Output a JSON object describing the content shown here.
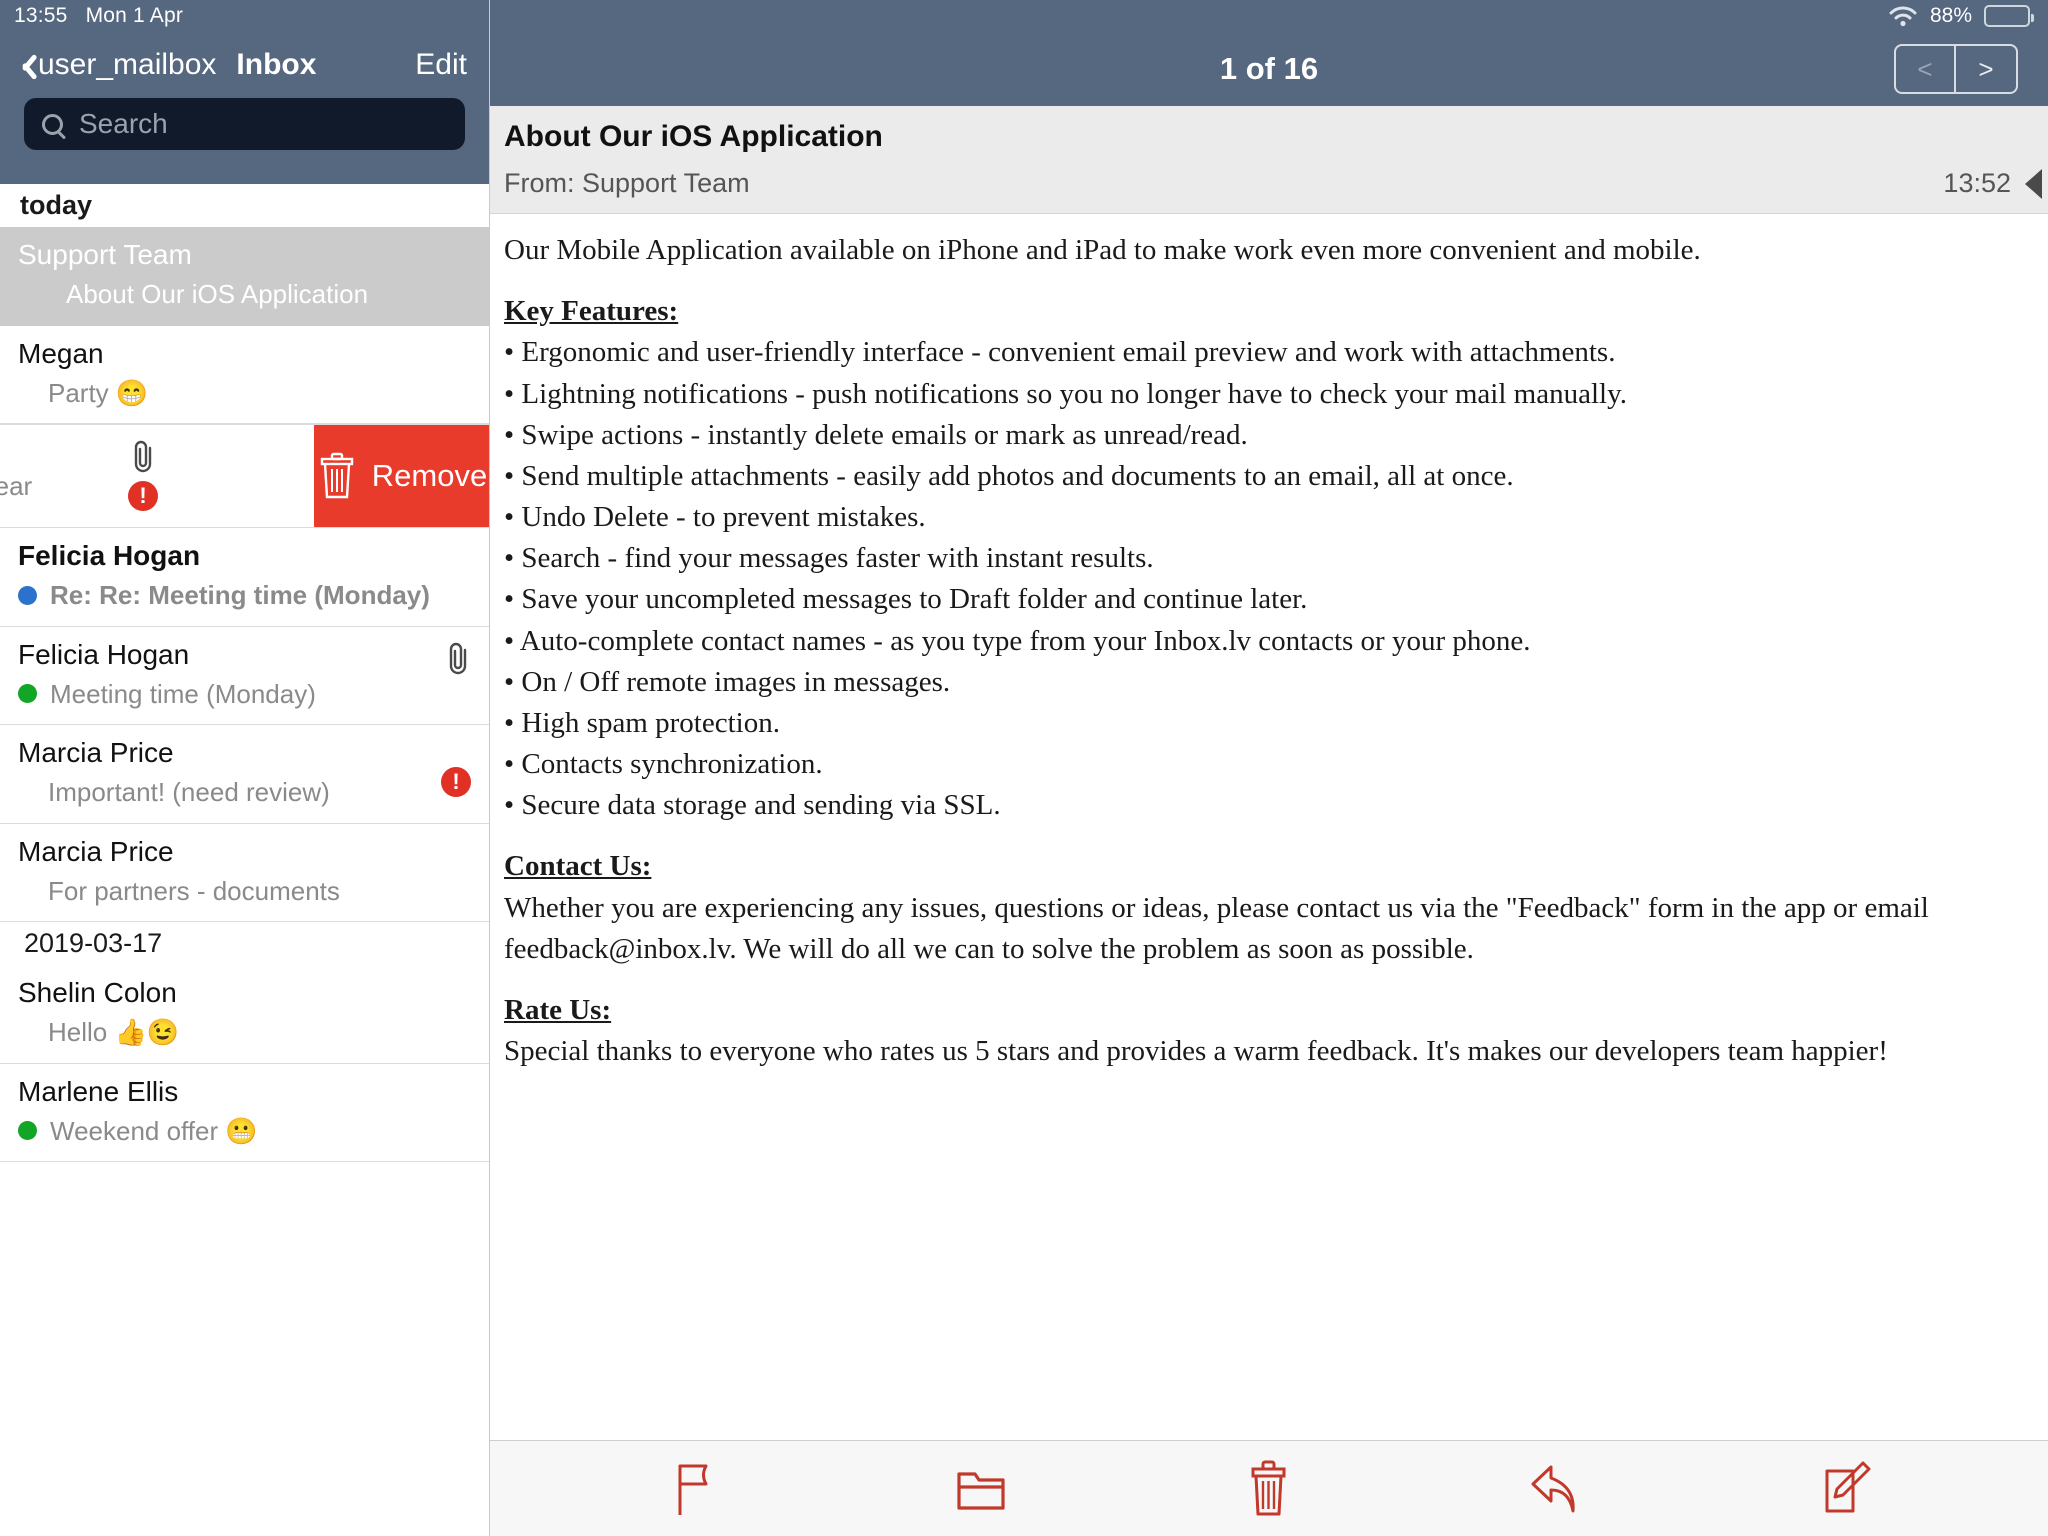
{
  "status_bar": {
    "time": "13:55",
    "date": "Mon 1 Apr",
    "battery_percent": "88%",
    "wifi_icon": "wifi-icon",
    "battery_icon": "battery-icon"
  },
  "left_pane": {
    "back_label": "user_mailbox",
    "back_icon": "chevron-left-icon",
    "title": "Inbox",
    "edit_label": "Edit",
    "search": {
      "placeholder": "Search",
      "value": "",
      "icon": "search-icon"
    },
    "sections": [
      {
        "header": "today",
        "rows": [
          {
            "sender": "Support Team",
            "subject": "About Our iOS Application",
            "selected": true,
            "unread": false,
            "dot": "none",
            "attachment": false,
            "important": false
          },
          {
            "sender": "Megan",
            "subject": "Party 😁",
            "selected": false,
            "unread": false,
            "dot": "none",
            "attachment": false,
            "important": false
          }
        ]
      }
    ],
    "swipe_row": {
      "subject_fragment": "ents for this year",
      "attachment_icon": "paperclip-icon",
      "important_icon": "exclamation-badge-icon",
      "action_label": "Remove",
      "action_icon": "trash-icon",
      "action_color": "#e83b2b"
    },
    "rows_after_swipe": [
      {
        "sender": "Felicia Hogan",
        "subject": "Re: Re: Meeting time (Monday)",
        "unread": true,
        "dot": "blue",
        "attachment": false,
        "important": false
      },
      {
        "sender": "Felicia Hogan",
        "subject": "Meeting time (Monday)",
        "unread": false,
        "dot": "green",
        "attachment": true,
        "important": false
      },
      {
        "sender": "Marcia Price",
        "subject": "Important! (need review)",
        "unread": false,
        "dot": "none",
        "attachment": false,
        "important": true
      },
      {
        "sender": "Marcia Price",
        "subject": "For partners - documents",
        "unread": false,
        "dot": "none",
        "attachment": false,
        "important": false
      }
    ],
    "section_dated": {
      "header": "2019-03-17",
      "rows": [
        {
          "sender": "Shelin Colon",
          "subject": "Hello 👍😉",
          "unread": false,
          "dot": "none",
          "attachment": false,
          "important": false
        },
        {
          "sender": "Marlene    Ellis",
          "subject": "Weekend offer 😬",
          "unread": false,
          "dot": "green",
          "attachment": false,
          "important": false
        }
      ]
    }
  },
  "right_pane": {
    "message_counter": "1 of 16",
    "prev_label": "<",
    "next_label": ">",
    "subject": "About Our iOS Application",
    "from": "From: Support Team",
    "time": "13:52",
    "reply_indicator_icon": "triangle-left-icon",
    "body": {
      "intro": "Our Mobile Application available on iPhone and iPad to make work even more convenient and mobile.",
      "features_heading": "Key Features:",
      "features": [
        "• Ergonomic and user-friendly interface - convenient email preview and work with attachments.",
        "• Lightning notifications - push notifications so you no longer have to check your mail manually.",
        "• Swipe actions - instantly delete emails or mark as unread/read.",
        "• Send multiple attachments - easily add photos and documents to an email, all at once.",
        "• Undo Delete - to prevent mistakes.",
        "• Search - find your messages faster with instant results.",
        "• Save your uncompleted messages to Draft folder and continue later.",
        "• Auto-complete contact names - as you type from your Inbox.lv contacts or your phone.",
        "• On / Off remote images in messages.",
        "• High spam protection.",
        "• Contacts synchronization.",
        "• Secure data storage and sending via SSL."
      ],
      "contact_heading": "Contact Us: ",
      "contact_text": "Whether you are experiencing any issues, questions or ideas, please contact us via the \"Feedback\" form in the app or email feedback@inbox.lv. We will do all we can to solve the problem as soon as possible.",
      "rate_heading": "Rate Us:",
      "rate_text": "Special thanks to everyone who rates us 5 stars and provides a warm feedback. It's makes our developers team happier!"
    },
    "toolbar": {
      "icon_color": "#c0392b",
      "items": [
        {
          "name": "flag-icon",
          "label": "Flag"
        },
        {
          "name": "folder-icon",
          "label": "Move to folder"
        },
        {
          "name": "trash-icon",
          "label": "Delete"
        },
        {
          "name": "reply-icon",
          "label": "Reply"
        },
        {
          "name": "compose-icon",
          "label": "Compose"
        }
      ]
    }
  }
}
